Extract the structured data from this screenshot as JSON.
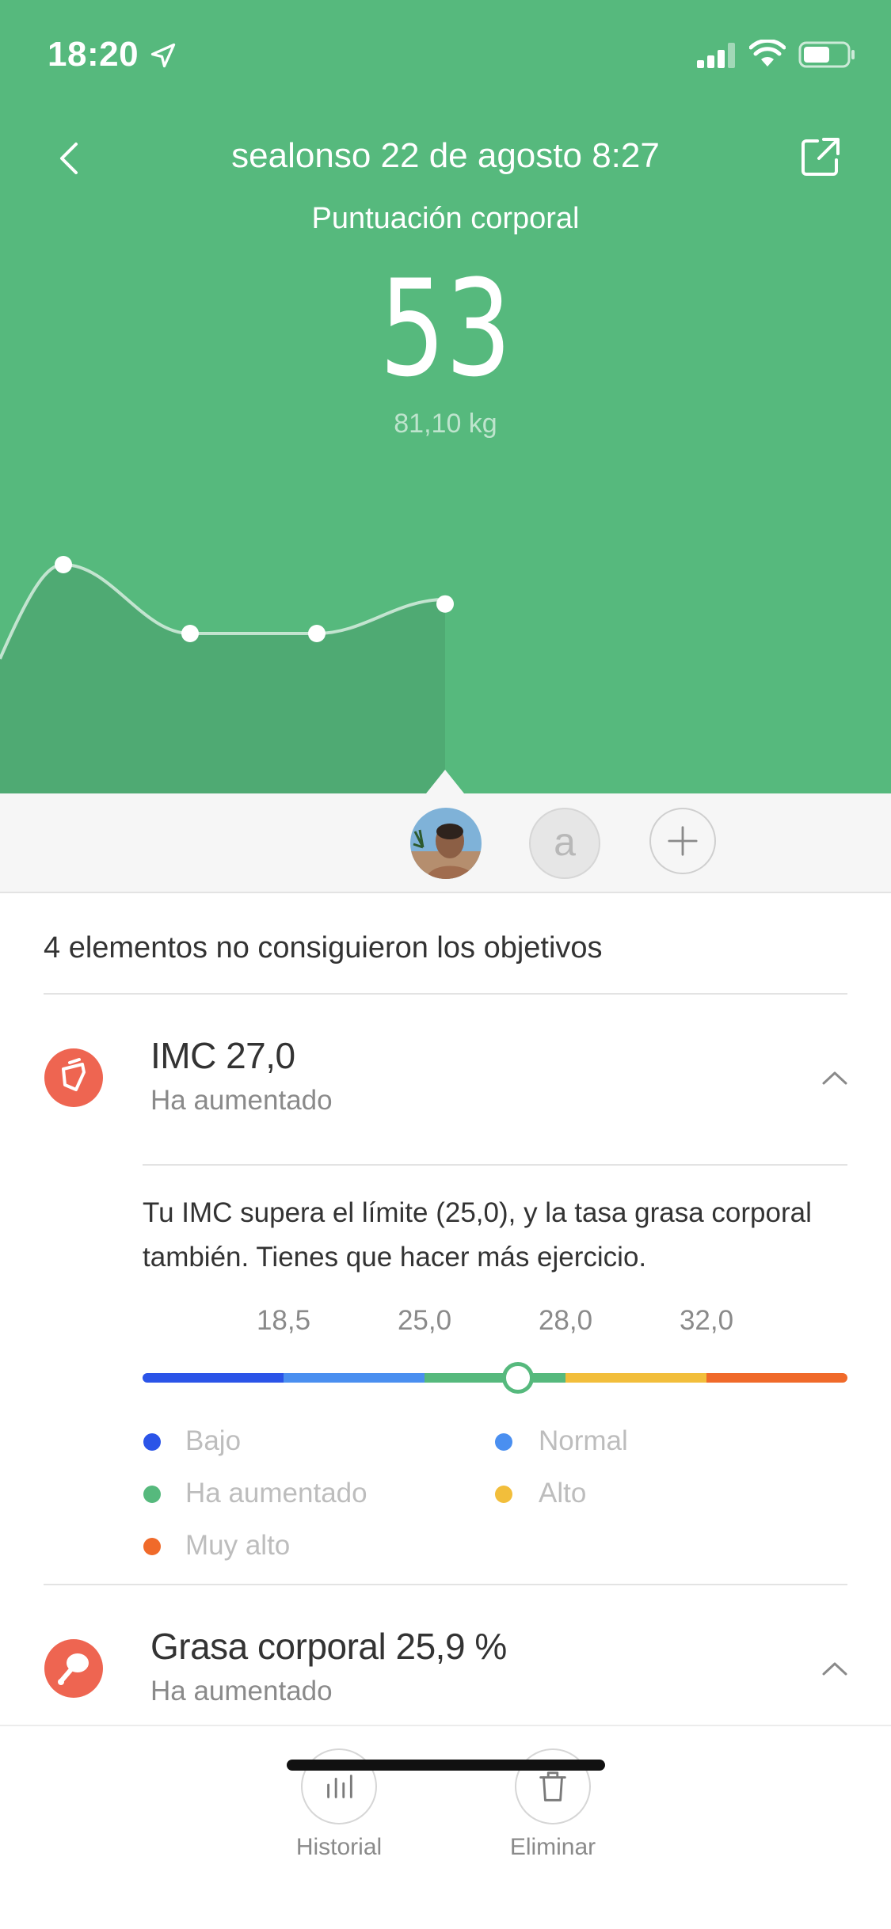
{
  "status_bar": {
    "time": "18:20"
  },
  "header": {
    "title": "sealonso 22 de agosto 8:27",
    "score_label": "Puntuación corporal",
    "score": "53",
    "weight": "81,10 kg"
  },
  "trend": {
    "points": [
      53,
      46,
      46,
      49
    ]
  },
  "users": {
    "second_initial": "a"
  },
  "summary": "4 elementos no consiguieron los objetivos",
  "bmi": {
    "title": "IMC 27,0",
    "status": "Ha aumentado",
    "description": "Tu IMC supera el límite (25,0), y la tasa grasa corporal también. Tienes que hacer más ejercicio.",
    "thresholds": [
      "18,5",
      "25,0",
      "28,0",
      "32,0"
    ],
    "value": 27.0,
    "colors": [
      "#2b54e8",
      "#4a8ff0",
      "#56b97d",
      "#f2be3b",
      "#f06a2a"
    ],
    "legend": [
      {
        "label": "Bajo",
        "color": "#2b54e8"
      },
      {
        "label": "Normal",
        "color": "#4a8ff0"
      },
      {
        "label": "Ha aumentado",
        "color": "#56b97d"
      },
      {
        "label": "Alto",
        "color": "#f2be3b"
      },
      {
        "label": "Muy alto",
        "color": "#f06a2a"
      }
    ]
  },
  "body_fat": {
    "title": "Grasa corporal 25,9 %",
    "status": "Ha aumentado"
  },
  "toolbar": {
    "history_label": "Historial",
    "delete_label": "Eliminar"
  }
}
